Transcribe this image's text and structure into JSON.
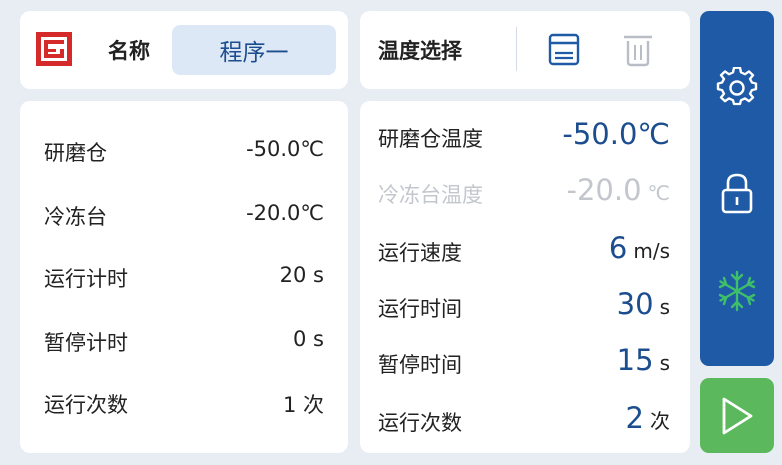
{
  "program": {
    "name_label": "名称",
    "name_value": "程序一"
  },
  "status": {
    "rows": [
      {
        "label": "研磨仓",
        "value": "-50.0℃"
      },
      {
        "label": "冷冻台",
        "value": "-20.0℃"
      },
      {
        "label": "运行计时",
        "value": "20  s"
      },
      {
        "label": "暂停计时",
        "value": "0  s"
      },
      {
        "label": "运行次数",
        "value": "1  次"
      }
    ]
  },
  "temperature": {
    "label": "温度选择",
    "icons": {
      "save": "save-icon",
      "delete": "trash-icon"
    }
  },
  "params": {
    "rows": [
      {
        "label": "研磨仓温度",
        "number": "-50.0℃",
        "unit": ""
      },
      {
        "label": "冷冻台温度",
        "number": "-20.0",
        "unit": "℃"
      },
      {
        "label": "运行速度",
        "number": "6",
        "unit": "m/s"
      },
      {
        "label": "运行时间",
        "number": "30",
        "unit": "s"
      },
      {
        "label": "暂停时间",
        "number": "15",
        "unit": "s"
      },
      {
        "label": "运行次数",
        "number": "2",
        "unit": "次"
      }
    ]
  },
  "sidebar": {
    "icons": [
      "gear-icon",
      "lock-icon",
      "snowflake-icon"
    ],
    "play_icon": "play-icon"
  },
  "colors": {
    "accent": "#1f5aa6",
    "value_blue": "#1c4d8e",
    "play_green": "#5cb85c",
    "snowflake_green": "#3ec06a",
    "logo_red": "#d42a2a",
    "disabled_gray": "#c3c7cd"
  }
}
